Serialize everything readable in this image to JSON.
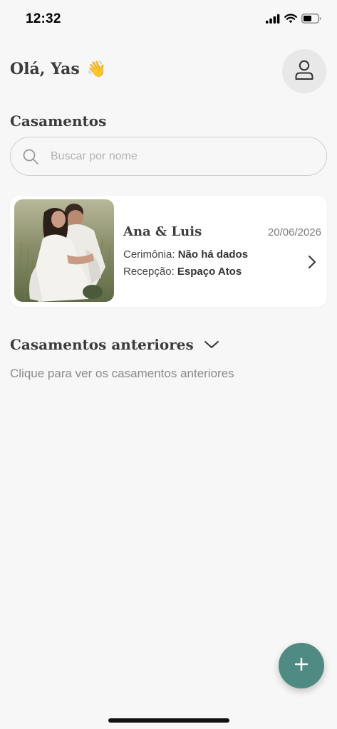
{
  "status_bar": {
    "time": "12:32"
  },
  "header": {
    "greeting": "Olá, Yas",
    "wave_emoji": "👋"
  },
  "weddings_section": {
    "title": "Casamentos"
  },
  "search": {
    "placeholder": "Buscar por nome",
    "value": ""
  },
  "wedding_card": {
    "names": "Ana & Luis",
    "date": "20/06/2026",
    "ceremony_label": "Cerimônia:",
    "ceremony_value": "Não há dados",
    "reception_label": "Recepção:",
    "reception_value": "Espaço Atos"
  },
  "previous_section": {
    "title": "Casamentos anteriores",
    "hint": "Clique para ver os casamentos anteriores"
  },
  "colors": {
    "accent": "#4f8b82",
    "background": "#f7f7f7",
    "card": "#ffffff"
  },
  "icons": [
    "signal-icon",
    "wifi-icon",
    "battery-icon",
    "user-icon",
    "search-icon",
    "chevron-right-icon",
    "chevron-down-icon",
    "plus-icon"
  ]
}
